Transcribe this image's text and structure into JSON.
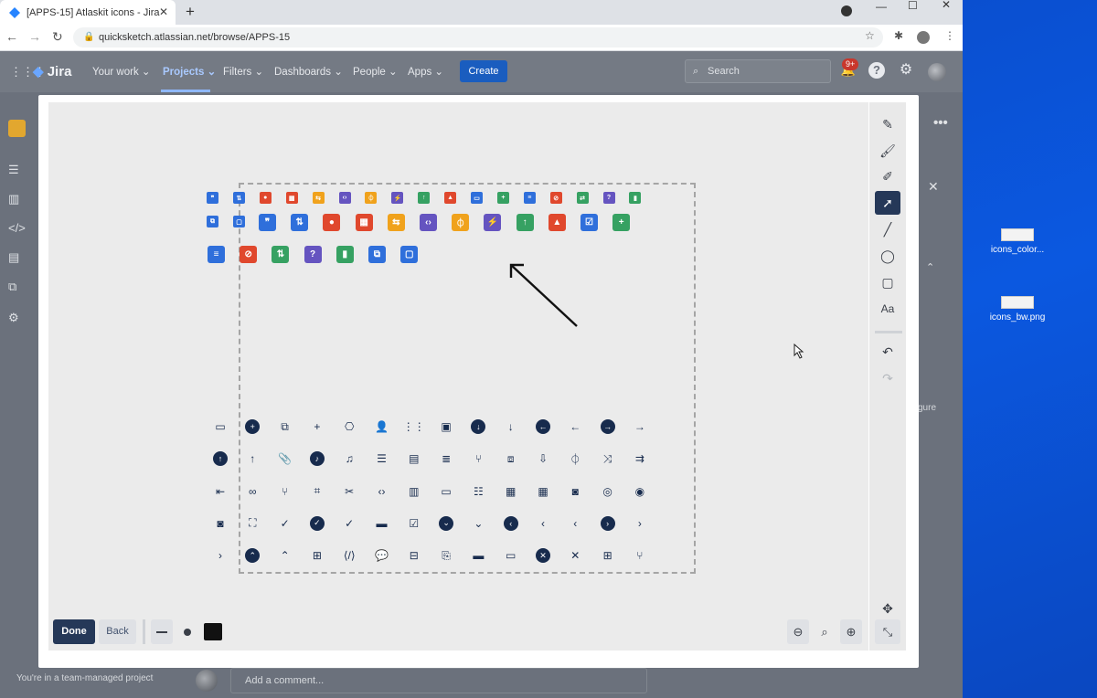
{
  "browser": {
    "tab_title": "[APPS-15] Atlaskit icons - Jira",
    "tab_close": "✕",
    "new_tab": "+",
    "url": "quicksketch.atlassian.net/browse/APPS-15"
  },
  "jira": {
    "logo": "Jira",
    "nav": [
      "Your work",
      "Projects",
      "Filters",
      "Dashboards",
      "People",
      "Apps"
    ],
    "create_label": "Create",
    "search_placeholder": "Search",
    "notification_count": "9+",
    "footer_text": "You're in a team-managed project",
    "comment_placeholder": "Add a comment...",
    "side_text": "gure"
  },
  "editor": {
    "done_label": "Done",
    "back_label": "Back"
  },
  "desktop": {
    "files": [
      "icons_color...",
      "icons_bw.png"
    ]
  },
  "colors": {
    "blue": "#2f6fdb",
    "red": "#e0482d",
    "orange": "#f0a21c",
    "purple": "#6554c0",
    "green": "#36a162",
    "dark": "#172b4d",
    "active_tool": "#253858"
  }
}
